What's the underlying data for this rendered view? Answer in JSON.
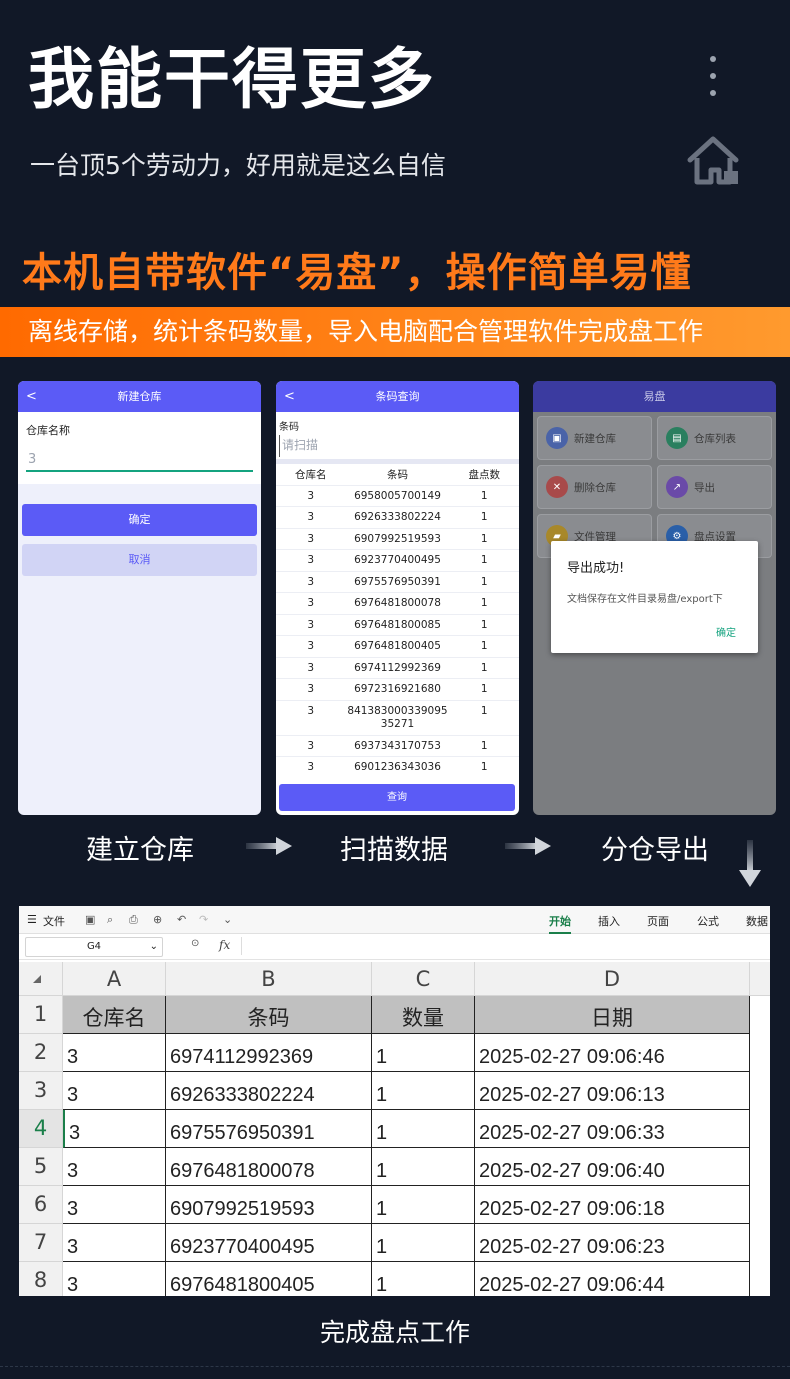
{
  "hero": {
    "title": "我能干得更多",
    "subtitle": "一台顶5个劳动力，好用就是这么自信"
  },
  "feature": {
    "title": "本机自带软件“易盘”，操作简单易懂",
    "banner": "离线存储，统计条码数量，导入电脑配合管理软件完成盘工作"
  },
  "phone1": {
    "bar_title": "新建仓库",
    "back": "<",
    "field_label": "仓库名称",
    "field_value": "3",
    "ok_label": "确定",
    "cancel_label": "取消"
  },
  "phone2": {
    "bar_title": "条码查询",
    "back": "<",
    "field_label": "条码",
    "scan_placeholder": "请扫描",
    "columns": [
      "仓库名",
      "条码",
      "盘点数"
    ],
    "rows": [
      [
        "3",
        "6958005700149",
        "1"
      ],
      [
        "3",
        "6926333802224",
        "1"
      ],
      [
        "3",
        "6907992519593",
        "1"
      ],
      [
        "3",
        "6923770400495",
        "1"
      ],
      [
        "3",
        "6975576950391",
        "1"
      ],
      [
        "3",
        "6976481800078",
        "1"
      ],
      [
        "3",
        "6976481800085",
        "1"
      ],
      [
        "3",
        "6976481800405",
        "1"
      ],
      [
        "3",
        "6974112992369",
        "1"
      ],
      [
        "3",
        "6972316921680",
        "1"
      ],
      [
        "3",
        "84138300033909535271",
        "1"
      ],
      [
        "3",
        "6937343170753",
        "1"
      ],
      [
        "3",
        "6901236343036",
        "1"
      ]
    ],
    "query_label": "查询"
  },
  "phone3": {
    "bar_title": "易盘",
    "tiles": [
      "新建仓库",
      "仓库列表",
      "删除仓库",
      "导出",
      "文件管理",
      "盘点设置"
    ],
    "dialog_title": "导出成功!",
    "dialog_message": "文档保存在文件目录易盘/export下",
    "dialog_ok": "确定"
  },
  "steps": [
    "建立仓库",
    "扫描数据",
    "分仓导出"
  ],
  "sheet": {
    "menu": "文件",
    "tabs": [
      "开始",
      "插入",
      "页面",
      "公式",
      "数据"
    ],
    "active_tab": "开始",
    "cell_ref": "G4",
    "fx": "fx",
    "col_letters": [
      "A",
      "B",
      "C",
      "D"
    ],
    "row_numbers": [
      "1",
      "2",
      "3",
      "4",
      "5",
      "6",
      "7",
      "8"
    ],
    "header": [
      "仓库名",
      "条码",
      "数量",
      "日期"
    ],
    "rows": [
      [
        "3",
        "6974112992369",
        "1",
        "2025-02-27 09:06:46"
      ],
      [
        "3",
        "6926333802224",
        "1",
        "2025-02-27 09:06:13"
      ],
      [
        "3",
        "6975576950391",
        "1",
        "2025-02-27 09:06:33"
      ],
      [
        "3",
        "6976481800078",
        "1",
        "2025-02-27 09:06:40"
      ],
      [
        "3",
        "6907992519593",
        "1",
        "2025-02-27 09:06:18"
      ],
      [
        "3",
        "6923770400495",
        "1",
        "2025-02-27 09:06:23"
      ],
      [
        "3",
        "6976481800405",
        "1",
        "2025-02-27 09:06:44"
      ]
    ]
  },
  "footer": "完成盘点工作",
  "colors": {
    "background": "#111827",
    "accent_orange": "#ff7a1a",
    "app_blue": "#5b5bf6",
    "sheet_green": "#1b7f4a"
  }
}
